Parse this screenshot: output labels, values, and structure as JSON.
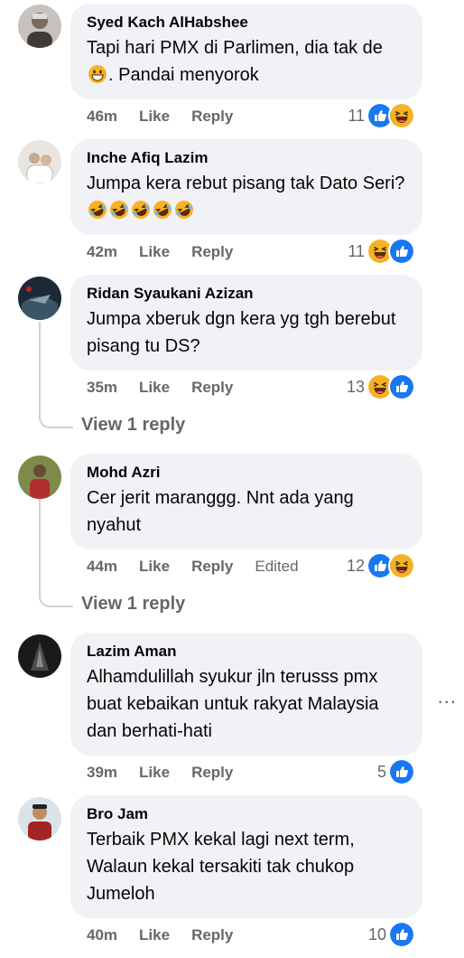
{
  "comments": [
    {
      "name": "Syed Kach AlHabshee",
      "text_before": "Tapi hari PMX di Parlimen, dia tak de ",
      "text_after": ". Pandai menyorok",
      "time": "46m",
      "like": "Like",
      "reply": "Reply",
      "react_count": "11",
      "reactions": [
        "like-icon",
        "haha-icon"
      ]
    },
    {
      "name": "Inche Afiq Lazim",
      "text": "Jumpa kera rebut pisang tak Dato Seri?",
      "emojis": [
        "rofl-icon",
        "rofl-icon",
        "rofl-icon",
        "rofl-icon",
        "rofl-icon"
      ],
      "time": "42m",
      "like": "Like",
      "reply": "Reply",
      "react_count": "11",
      "reactions": [
        "haha-icon",
        "like-icon"
      ]
    },
    {
      "name": "Ridan Syaukani Azizan",
      "text": "Jumpa xberuk dgn kera yg tgh berebut pisang tu DS?",
      "time": "35m",
      "like": "Like",
      "reply": "Reply",
      "react_count": "13",
      "reactions": [
        "haha-icon",
        "like-icon"
      ],
      "view_replies": "View 1 reply"
    },
    {
      "name": "Mohd Azri",
      "text": "Cer jerit maranggg. Nnt ada yang nyahut",
      "time": "44m",
      "like": "Like",
      "reply": "Reply",
      "edited": "Edited",
      "react_count": "12",
      "reactions": [
        "like-icon",
        "haha-icon"
      ],
      "view_replies": "View 1 reply"
    },
    {
      "name": "Lazim Aman",
      "text": "Alhamdulillah syukur jln terusss pmx buat kebaikan untuk rakyat Malaysia dan berhati-hati",
      "time": "39m",
      "like": "Like",
      "reply": "Reply",
      "react_count": "5",
      "reactions": [
        "like-icon"
      ]
    },
    {
      "name": "Bro Jam",
      "text": "Terbaik PMX kekal lagi next term, Walaun kekal tersakiti tak chukop Jumeloh",
      "time": "40m",
      "like": "Like",
      "reply": "Reply",
      "react_count": "10",
      "reactions": [
        "like-icon"
      ]
    }
  ],
  "more_options": "...",
  "colors": {
    "bubble": "#f0f2f5",
    "like_blue": "#1877f2",
    "haha_yellow": "#f7b125",
    "meta_gray": "#65676b"
  }
}
